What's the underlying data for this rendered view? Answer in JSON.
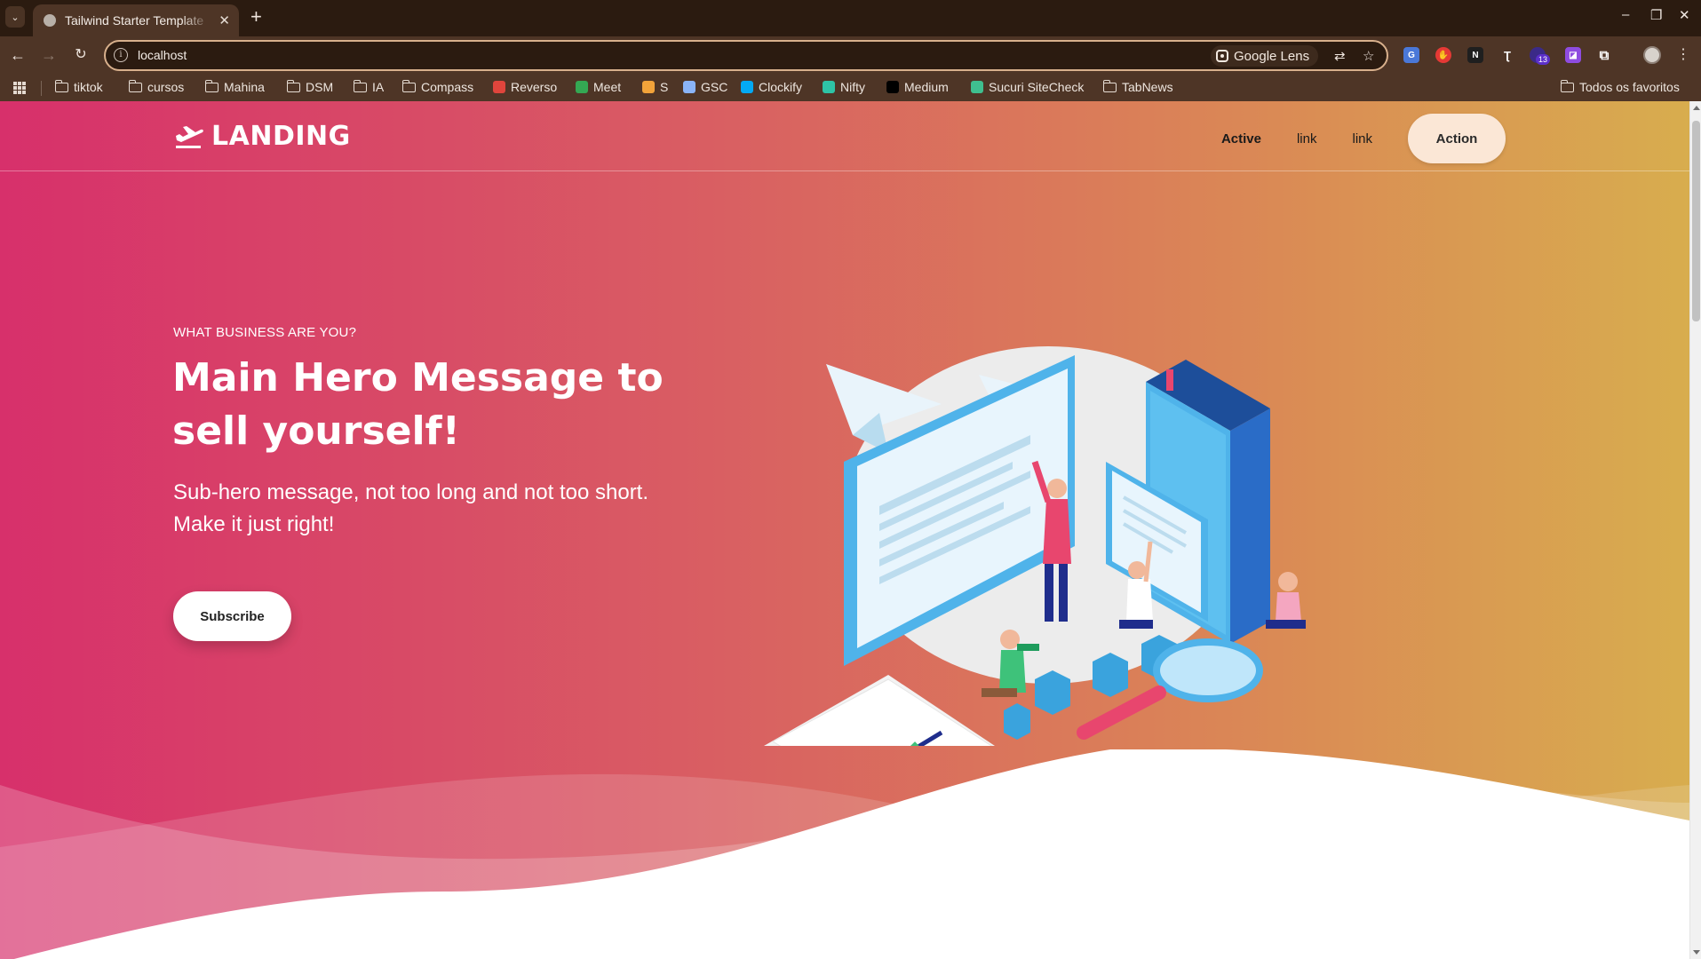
{
  "browser": {
    "tab_title": "Tailwind Starter Template",
    "address": "localhost",
    "lens_label": "Google Lens",
    "extension_badge": "13",
    "bookmarks": [
      {
        "label": "tiktok",
        "type": "folder"
      },
      {
        "label": "cursos",
        "type": "folder"
      },
      {
        "label": "Mahina",
        "type": "folder"
      },
      {
        "label": "DSM",
        "type": "folder"
      },
      {
        "label": "IA",
        "type": "folder"
      },
      {
        "label": "Compass",
        "type": "folder"
      },
      {
        "label": "Reverso",
        "type": "site",
        "color": "#e0453c"
      },
      {
        "label": "Meet",
        "type": "site",
        "color": "#34a853"
      },
      {
        "label": "S",
        "type": "site",
        "color": "#f2a33a"
      },
      {
        "label": "GSC",
        "type": "site",
        "color": "#8ab4f8"
      },
      {
        "label": "Clockify",
        "type": "site",
        "color": "#03a9f4"
      },
      {
        "label": "Nifty",
        "type": "site",
        "color": "#2ec4a6"
      },
      {
        "label": "Medium",
        "type": "site",
        "color": "#000000"
      },
      {
        "label": "Sucuri SiteCheck",
        "type": "site",
        "color": "#3fbf8f"
      },
      {
        "label": "TabNews",
        "type": "folder"
      }
    ],
    "all_bookmarks": "Todos os favoritos"
  },
  "site": {
    "logo_text": "LANDING",
    "nav": {
      "active": "Active",
      "link1": "link",
      "link2": "link",
      "action": "Action"
    },
    "hero": {
      "eyebrow": "WHAT BUSINESS ARE YOU?",
      "title": "Main Hero Message to sell yourself!",
      "subtitle": "Sub-hero message, not too long and not too short. Make it just right!",
      "cta": "Subscribe"
    }
  },
  "colors": {
    "gradient_start": "#d7306b",
    "gradient_end": "#d8ae4e",
    "action_bg": "#fbe7d6"
  }
}
